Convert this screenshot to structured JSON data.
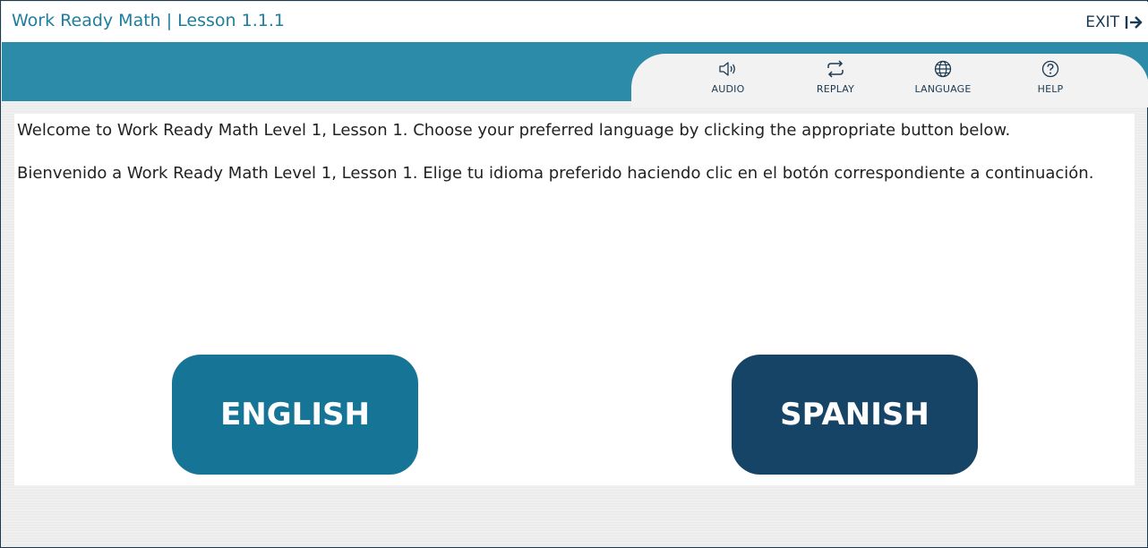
{
  "header": {
    "title": "Work Ready Math | Lesson 1.1.1",
    "exit_label": "EXIT"
  },
  "toolbar": {
    "items": [
      {
        "label": "AUDIO",
        "icon": "speaker-icon"
      },
      {
        "label": "REPLAY",
        "icon": "replay-icon"
      },
      {
        "label": "LANGUAGE",
        "icon": "globe-icon"
      },
      {
        "label": "HELP",
        "icon": "question-icon"
      }
    ]
  },
  "content": {
    "english_text": "Welcome to Work Ready Math Level 1, Lesson 1. Choose your preferred language by clicking the appropriate button below.",
    "spanish_text": "Bienvenido a Work Ready Math Level 1, Lesson 1. Elige tu idioma preferido haciendo clic en el botón correspondiente a continuación."
  },
  "buttons": {
    "english": "ENGLISH",
    "spanish": "SPANISH"
  },
  "colors": {
    "title": "#1f7d9e",
    "band": "#2b8ba8",
    "english_button": "#167596",
    "spanish_button": "#164466",
    "dark_text": "#1b3a52"
  }
}
